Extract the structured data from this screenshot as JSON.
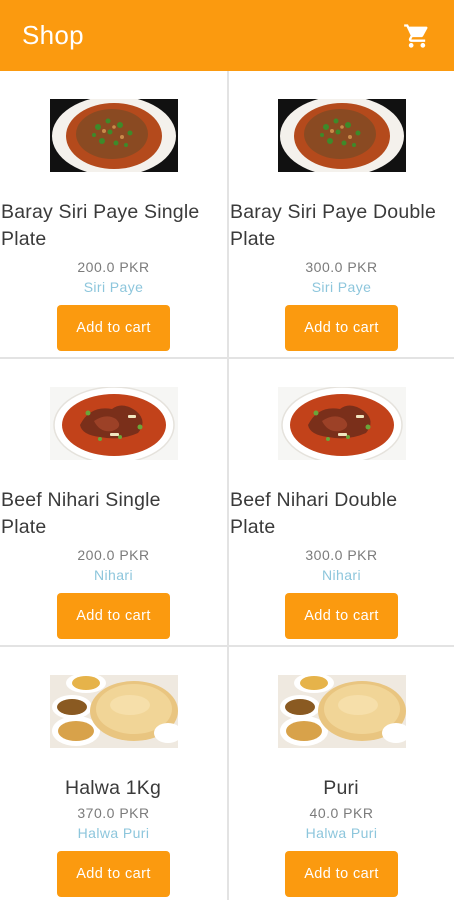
{
  "appbar": {
    "title": "Shop",
    "cart_icon": "shopping-cart-icon",
    "color": "#fb9a0f"
  },
  "accent_color": "#fb9a0f",
  "category_color": "#8dc6dc",
  "products": [
    {
      "name_line1": "Baray Siri Paye Single",
      "name_line2": "Plate",
      "price": "200.0 PKR",
      "category": "Siri Paye",
      "button": "Add to cart",
      "image": "siri-paye-dish"
    },
    {
      "name_line1": "Baray Siri Paye Double",
      "name_line2": "Plate",
      "price": "300.0 PKR",
      "category": "Siri Paye",
      "button": "Add to cart",
      "image": "siri-paye-dish"
    },
    {
      "name_line1": "Beef Nihari Single",
      "name_line2": "Plate",
      "price": "200.0 PKR",
      "category": "Nihari",
      "button": "Add to cart",
      "image": "nihari-dish"
    },
    {
      "name_line1": "Beef Nihari Double",
      "name_line2": "Plate",
      "price": "300.0 PKR",
      "category": "Nihari",
      "button": "Add to cart",
      "image": "nihari-dish"
    },
    {
      "name_line1": "Halwa 1Kg",
      "name_line2": "",
      "price": "370.0 PKR",
      "category": "Halwa Puri",
      "button": "Add to cart",
      "image": "halwa-puri-platter"
    },
    {
      "name_line1": "Puri",
      "name_line2": "",
      "price": "40.0 PKR",
      "category": "Halwa Puri",
      "button": "Add to cart",
      "image": "halwa-puri-platter"
    }
  ]
}
